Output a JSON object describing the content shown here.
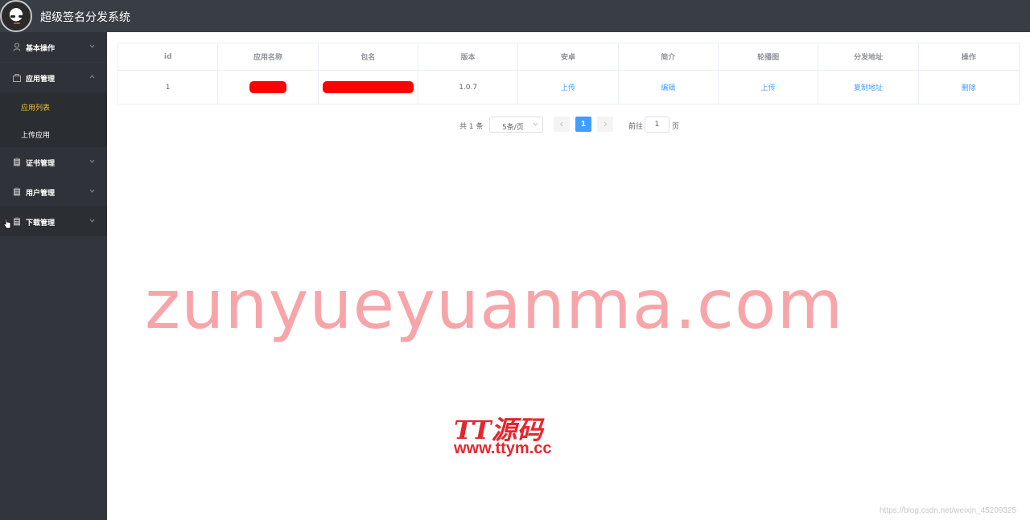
{
  "header": {
    "title": "超级签名分发系统"
  },
  "sidebar": {
    "menus": [
      {
        "label": "基本操作",
        "icon": "user-icon",
        "expanded": false
      },
      {
        "label": "应用管理",
        "icon": "bag-icon",
        "expanded": true,
        "children": [
          {
            "label": "应用列表",
            "active": true
          },
          {
            "label": "上传应用",
            "active": false
          }
        ]
      },
      {
        "label": "证书管理",
        "icon": "clipboard-icon",
        "expanded": false
      },
      {
        "label": "用户管理",
        "icon": "clipboard-icon",
        "expanded": false
      },
      {
        "label": "下载管理",
        "icon": "clipboard-icon",
        "expanded": false
      }
    ]
  },
  "table": {
    "columns": [
      "id",
      "应用名称",
      "包名",
      "版本",
      "安卓",
      "简介",
      "轮播图",
      "分发地址",
      "操作"
    ],
    "rows": [
      {
        "id": "1",
        "version": "1.0.7",
        "android": "上传",
        "intro": "编辑",
        "carousel": "上传",
        "dist": "复制地址",
        "action": "删除"
      }
    ]
  },
  "pagination": {
    "total": "共 1 条",
    "page_size": "5条/页",
    "current_page": "1",
    "goto_label": "前往",
    "goto_value": "1",
    "page_unit": "页"
  },
  "watermarks": {
    "big": "zunyueyuanma.com",
    "logo": "TT源码",
    "url": "www.ttym.cc",
    "small": "https://blog.csdn.net/weixin_45209325"
  },
  "colors": {
    "header_bg": "#393d44",
    "sidebar_bg": "#32353b",
    "active_sub": "#f2c23b",
    "link": "#409eff",
    "redact": "#ff0000"
  }
}
